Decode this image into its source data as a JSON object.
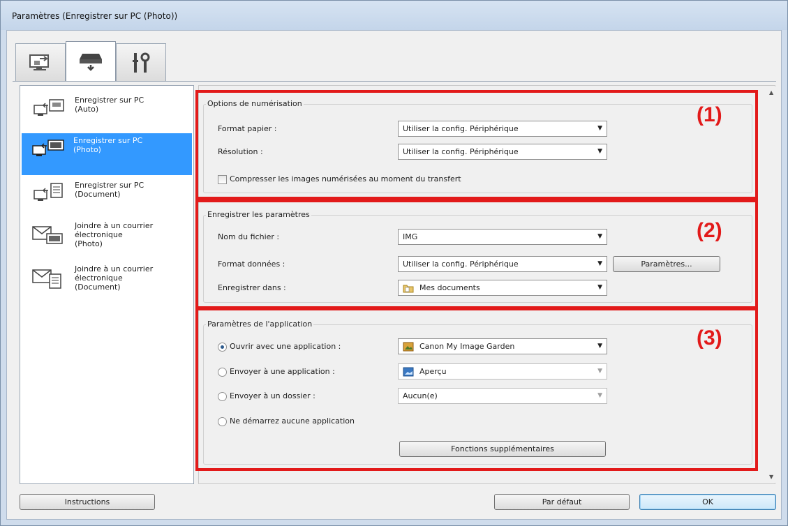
{
  "window": {
    "title": "Paramètres (Enregistrer sur PC (Photo))"
  },
  "tabs": [
    {
      "icon": "computer-scan-icon"
    },
    {
      "icon": "scanner-icon",
      "selected": true
    },
    {
      "icon": "tools-icon"
    }
  ],
  "sidebar": {
    "items": [
      {
        "label": "Enregistrer sur PC\n(Auto)",
        "icon": "save-to-pc-auto-icon",
        "selected": false
      },
      {
        "label": "Enregistrer sur PC\n(Photo)",
        "icon": "save-to-pc-photo-icon",
        "selected": true
      },
      {
        "label": "Enregistrer sur PC\n(Document)",
        "icon": "save-to-pc-document-icon",
        "selected": false
      },
      {
        "label": "Joindre à un courrier\nélectronique\n(Photo)",
        "icon": "email-photo-icon",
        "selected": false
      },
      {
        "label": "Joindre à un courrier\nélectronique\n(Document)",
        "icon": "email-document-icon",
        "selected": false
      }
    ]
  },
  "scan_options": {
    "title": "Options de numérisation",
    "marker": "(1)",
    "paper_size_label": "Format papier :",
    "paper_size_value": "Utiliser la config. Périphérique",
    "resolution_label": "Résolution :",
    "resolution_value": "Utiliser la config. Périphérique",
    "compress_label": "Compresser les images numérisées au moment du transfert",
    "compress_checked": false
  },
  "save_settings": {
    "title": "Enregistrer les paramètres",
    "marker": "(2)",
    "filename_label": "Nom du fichier :",
    "filename_value": "IMG",
    "data_format_label": "Format données :",
    "data_format_value": "Utiliser la config. Périphérique",
    "settings_button": "Paramètres...",
    "save_in_label": "Enregistrer dans :",
    "save_in_value": "Mes documents"
  },
  "app_settings": {
    "title": "Paramètres de l'application",
    "marker": "(3)",
    "open_app_label": "Ouvrir avec une application :",
    "open_app_value": "Canon My Image Garden",
    "send_app_label": "Envoyer à une application :",
    "send_app_value": "Aperçu",
    "send_folder_label": "Envoyer à un dossier :",
    "send_folder_value": "Aucun(e)",
    "no_app_label": "Ne démarrez aucune application",
    "selected_option": "open_app",
    "more_functions_button": "Fonctions supplémentaires"
  },
  "footer": {
    "instructions_button": "Instructions",
    "defaults_button": "Par défaut",
    "ok_button": "OK"
  },
  "colors": {
    "highlight": "#e21a1a",
    "selection": "#3399ff"
  }
}
